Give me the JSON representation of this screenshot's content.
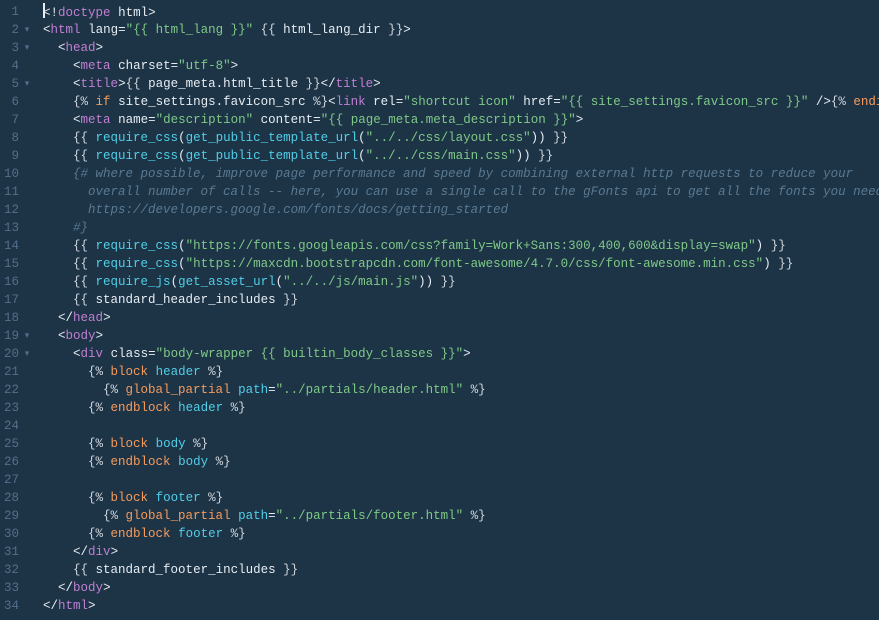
{
  "lines": [
    {
      "n": 1,
      "fold": false,
      "indent": 0,
      "cursor": true,
      "tokens": [
        {
          "c": "c-punct",
          "t": "<!"
        },
        {
          "c": "c-tag",
          "t": "doctype"
        },
        {
          "c": "",
          "t": " "
        },
        {
          "c": "c-attr",
          "t": "html"
        },
        {
          "c": "c-punct",
          "t": ">"
        }
      ]
    },
    {
      "n": 2,
      "fold": true,
      "indent": 0,
      "tokens": [
        {
          "c": "c-punct",
          "t": "<"
        },
        {
          "c": "c-tag",
          "t": "html"
        },
        {
          "c": "",
          "t": " "
        },
        {
          "c": "c-attr",
          "t": "lang"
        },
        {
          "c": "c-punct",
          "t": "="
        },
        {
          "c": "c-str",
          "t": "\"{{ html_lang }}\""
        },
        {
          "c": "",
          "t": " "
        },
        {
          "c": "c-delim",
          "t": "{{ "
        },
        {
          "c": "c-attr",
          "t": "html_lang_dir"
        },
        {
          "c": "c-delim",
          "t": " }}"
        },
        {
          "c": "c-punct",
          "t": ">"
        }
      ]
    },
    {
      "n": 3,
      "fold": true,
      "indent": 1,
      "tokens": [
        {
          "c": "c-punct",
          "t": "<"
        },
        {
          "c": "c-tag",
          "t": "head"
        },
        {
          "c": "c-punct",
          "t": ">"
        }
      ]
    },
    {
      "n": 4,
      "fold": false,
      "indent": 2,
      "tokens": [
        {
          "c": "c-punct",
          "t": "<"
        },
        {
          "c": "c-tag",
          "t": "meta"
        },
        {
          "c": "",
          "t": " "
        },
        {
          "c": "c-attr",
          "t": "charset"
        },
        {
          "c": "c-punct",
          "t": "="
        },
        {
          "c": "c-str",
          "t": "\"utf-8\""
        },
        {
          "c": "c-punct",
          "t": ">"
        }
      ]
    },
    {
      "n": 5,
      "fold": true,
      "indent": 2,
      "tokens": [
        {
          "c": "c-punct",
          "t": "<"
        },
        {
          "c": "c-tag",
          "t": "title"
        },
        {
          "c": "c-punct",
          "t": ">"
        },
        {
          "c": "c-delim",
          "t": "{{ "
        },
        {
          "c": "c-attr",
          "t": "page_meta.html_title"
        },
        {
          "c": "c-delim",
          "t": " }}"
        },
        {
          "c": "c-punct",
          "t": "</"
        },
        {
          "c": "c-tag",
          "t": "title"
        },
        {
          "c": "c-punct",
          "t": ">"
        }
      ]
    },
    {
      "n": 6,
      "fold": false,
      "indent": 2,
      "tokens": [
        {
          "c": "c-delim",
          "t": "{% "
        },
        {
          "c": "c-kw",
          "t": "if"
        },
        {
          "c": "",
          "t": " "
        },
        {
          "c": "c-attr",
          "t": "site_settings.favicon_src"
        },
        {
          "c": "c-delim",
          "t": " %}"
        },
        {
          "c": "c-punct",
          "t": "<"
        },
        {
          "c": "c-tag",
          "t": "link"
        },
        {
          "c": "",
          "t": " "
        },
        {
          "c": "c-attr",
          "t": "rel"
        },
        {
          "c": "c-punct",
          "t": "="
        },
        {
          "c": "c-str",
          "t": "\"shortcut icon\""
        },
        {
          "c": "",
          "t": " "
        },
        {
          "c": "c-attr",
          "t": "href"
        },
        {
          "c": "c-punct",
          "t": "="
        },
        {
          "c": "c-str",
          "t": "\"{{ site_settings.favicon_src }}\""
        },
        {
          "c": "",
          "t": " "
        },
        {
          "c": "c-punct",
          "t": "/>"
        },
        {
          "c": "c-delim",
          "t": "{% "
        },
        {
          "c": "c-kw",
          "t": "endif"
        },
        {
          "c": "c-delim",
          "t": " %}"
        }
      ]
    },
    {
      "n": 7,
      "fold": false,
      "indent": 2,
      "tokens": [
        {
          "c": "c-punct",
          "t": "<"
        },
        {
          "c": "c-tag",
          "t": "meta"
        },
        {
          "c": "",
          "t": " "
        },
        {
          "c": "c-attr",
          "t": "name"
        },
        {
          "c": "c-punct",
          "t": "="
        },
        {
          "c": "c-str",
          "t": "\"description\""
        },
        {
          "c": "",
          "t": " "
        },
        {
          "c": "c-attr",
          "t": "content"
        },
        {
          "c": "c-punct",
          "t": "="
        },
        {
          "c": "c-str",
          "t": "\"{{ page_meta.meta_description }}\""
        },
        {
          "c": "c-punct",
          "t": ">"
        }
      ]
    },
    {
      "n": 8,
      "fold": false,
      "indent": 2,
      "tokens": [
        {
          "c": "c-delim",
          "t": "{{ "
        },
        {
          "c": "c-call",
          "t": "require_css"
        },
        {
          "c": "c-punct",
          "t": "("
        },
        {
          "c": "c-call",
          "t": "get_public_template_url"
        },
        {
          "c": "c-punct",
          "t": "("
        },
        {
          "c": "c-str",
          "t": "\"../../css/layout.css\""
        },
        {
          "c": "c-punct",
          "t": "))"
        },
        {
          "c": "c-delim",
          "t": " }}"
        }
      ]
    },
    {
      "n": 9,
      "fold": false,
      "indent": 2,
      "tokens": [
        {
          "c": "c-delim",
          "t": "{{ "
        },
        {
          "c": "c-call",
          "t": "require_css"
        },
        {
          "c": "c-punct",
          "t": "("
        },
        {
          "c": "c-call",
          "t": "get_public_template_url"
        },
        {
          "c": "c-punct",
          "t": "("
        },
        {
          "c": "c-str",
          "t": "\"../../css/main.css\""
        },
        {
          "c": "c-punct",
          "t": "))"
        },
        {
          "c": "c-delim",
          "t": " }}"
        }
      ]
    },
    {
      "n": 10,
      "fold": false,
      "indent": 2,
      "tokens": [
        {
          "c": "c-cmt",
          "t": "{# where possible, improve page performance and speed by combining external http requests to reduce your"
        }
      ]
    },
    {
      "n": 11,
      "fold": false,
      "indent": 3,
      "tokens": [
        {
          "c": "c-cmt",
          "t": "overall number of calls -- here, you can use a single call to the gFonts api to get all the fonts you need"
        }
      ]
    },
    {
      "n": 12,
      "fold": false,
      "indent": 3,
      "tokens": [
        {
          "c": "c-cmt",
          "t": "https://developers.google.com/fonts/docs/getting_started"
        }
      ]
    },
    {
      "n": 13,
      "fold": false,
      "indent": 2,
      "tokens": [
        {
          "c": "c-cmt",
          "t": "#}"
        }
      ]
    },
    {
      "n": 14,
      "fold": false,
      "indent": 2,
      "tokens": [
        {
          "c": "c-delim",
          "t": "{{ "
        },
        {
          "c": "c-call",
          "t": "require_css"
        },
        {
          "c": "c-punct",
          "t": "("
        },
        {
          "c": "c-str",
          "t": "\"https://fonts.googleapis.com/css?family=Work+Sans:300,400,600&display=swap\""
        },
        {
          "c": "c-punct",
          "t": ")"
        },
        {
          "c": "c-delim",
          "t": " }}"
        }
      ]
    },
    {
      "n": 15,
      "fold": false,
      "indent": 2,
      "tokens": [
        {
          "c": "c-delim",
          "t": "{{ "
        },
        {
          "c": "c-call",
          "t": "require_css"
        },
        {
          "c": "c-punct",
          "t": "("
        },
        {
          "c": "c-str",
          "t": "\"https://maxcdn.bootstrapcdn.com/font-awesome/4.7.0/css/font-awesome.min.css\""
        },
        {
          "c": "c-punct",
          "t": ")"
        },
        {
          "c": "c-delim",
          "t": " }}"
        }
      ]
    },
    {
      "n": 16,
      "fold": false,
      "indent": 2,
      "tokens": [
        {
          "c": "c-delim",
          "t": "{{ "
        },
        {
          "c": "c-call",
          "t": "require_js"
        },
        {
          "c": "c-punct",
          "t": "("
        },
        {
          "c": "c-call",
          "t": "get_asset_url"
        },
        {
          "c": "c-punct",
          "t": "("
        },
        {
          "c": "c-str",
          "t": "\"../../js/main.js\""
        },
        {
          "c": "c-punct",
          "t": "))"
        },
        {
          "c": "c-delim",
          "t": " }}"
        }
      ]
    },
    {
      "n": 17,
      "fold": false,
      "indent": 2,
      "tokens": [
        {
          "c": "c-delim",
          "t": "{{ "
        },
        {
          "c": "c-attr",
          "t": "standard_header_includes"
        },
        {
          "c": "c-delim",
          "t": " }}"
        }
      ]
    },
    {
      "n": 18,
      "fold": false,
      "indent": 1,
      "tokens": [
        {
          "c": "c-punct",
          "t": "</"
        },
        {
          "c": "c-tag",
          "t": "head"
        },
        {
          "c": "c-punct",
          "t": ">"
        }
      ]
    },
    {
      "n": 19,
      "fold": true,
      "indent": 1,
      "tokens": [
        {
          "c": "c-punct",
          "t": "<"
        },
        {
          "c": "c-tag",
          "t": "body"
        },
        {
          "c": "c-punct",
          "t": ">"
        }
      ]
    },
    {
      "n": 20,
      "fold": true,
      "indent": 2,
      "tokens": [
        {
          "c": "c-punct",
          "t": "<"
        },
        {
          "c": "c-tag",
          "t": "div"
        },
        {
          "c": "",
          "t": " "
        },
        {
          "c": "c-attr",
          "t": "class"
        },
        {
          "c": "c-punct",
          "t": "="
        },
        {
          "c": "c-str",
          "t": "\"body-wrapper {{ builtin_body_classes }}\""
        },
        {
          "c": "c-punct",
          "t": ">"
        }
      ]
    },
    {
      "n": 21,
      "fold": false,
      "indent": 3,
      "tokens": [
        {
          "c": "c-delim",
          "t": "{% "
        },
        {
          "c": "c-block",
          "t": "block"
        },
        {
          "c": "",
          "t": " "
        },
        {
          "c": "c-name",
          "t": "header"
        },
        {
          "c": "c-delim",
          "t": " %}"
        }
      ]
    },
    {
      "n": 22,
      "fold": false,
      "indent": 4,
      "tokens": [
        {
          "c": "c-delim",
          "t": "{% "
        },
        {
          "c": "c-block",
          "t": "global_partial"
        },
        {
          "c": "",
          "t": " "
        },
        {
          "c": "c-name",
          "t": "path"
        },
        {
          "c": "c-punct",
          "t": "="
        },
        {
          "c": "c-str",
          "t": "\"../partials/header.html\""
        },
        {
          "c": "c-delim",
          "t": " %}"
        }
      ]
    },
    {
      "n": 23,
      "fold": false,
      "indent": 3,
      "tokens": [
        {
          "c": "c-delim",
          "t": "{% "
        },
        {
          "c": "c-block",
          "t": "endblock"
        },
        {
          "c": "",
          "t": " "
        },
        {
          "c": "c-name",
          "t": "header"
        },
        {
          "c": "c-delim",
          "t": " %}"
        }
      ]
    },
    {
      "n": 24,
      "fold": false,
      "indent": 3,
      "tokens": []
    },
    {
      "n": 25,
      "fold": false,
      "indent": 3,
      "tokens": [
        {
          "c": "c-delim",
          "t": "{% "
        },
        {
          "c": "c-block",
          "t": "block"
        },
        {
          "c": "",
          "t": " "
        },
        {
          "c": "c-name",
          "t": "body"
        },
        {
          "c": "c-delim",
          "t": " %}"
        }
      ]
    },
    {
      "n": 26,
      "fold": false,
      "indent": 3,
      "tokens": [
        {
          "c": "c-delim",
          "t": "{% "
        },
        {
          "c": "c-block",
          "t": "endblock"
        },
        {
          "c": "",
          "t": " "
        },
        {
          "c": "c-name",
          "t": "body"
        },
        {
          "c": "c-delim",
          "t": " %}"
        }
      ]
    },
    {
      "n": 27,
      "fold": false,
      "indent": 3,
      "tokens": []
    },
    {
      "n": 28,
      "fold": false,
      "indent": 3,
      "tokens": [
        {
          "c": "c-delim",
          "t": "{% "
        },
        {
          "c": "c-block",
          "t": "block"
        },
        {
          "c": "",
          "t": " "
        },
        {
          "c": "c-name",
          "t": "footer"
        },
        {
          "c": "c-delim",
          "t": " %}"
        }
      ]
    },
    {
      "n": 29,
      "fold": false,
      "indent": 4,
      "tokens": [
        {
          "c": "c-delim",
          "t": "{% "
        },
        {
          "c": "c-block",
          "t": "global_partial"
        },
        {
          "c": "",
          "t": " "
        },
        {
          "c": "c-name",
          "t": "path"
        },
        {
          "c": "c-punct",
          "t": "="
        },
        {
          "c": "c-str",
          "t": "\"../partials/footer.html\""
        },
        {
          "c": "c-delim",
          "t": " %}"
        }
      ]
    },
    {
      "n": 30,
      "fold": false,
      "indent": 3,
      "tokens": [
        {
          "c": "c-delim",
          "t": "{% "
        },
        {
          "c": "c-block",
          "t": "endblock"
        },
        {
          "c": "",
          "t": " "
        },
        {
          "c": "c-name",
          "t": "footer"
        },
        {
          "c": "c-delim",
          "t": " %}"
        }
      ]
    },
    {
      "n": 31,
      "fold": false,
      "indent": 2,
      "tokens": [
        {
          "c": "c-punct",
          "t": "</"
        },
        {
          "c": "c-tag",
          "t": "div"
        },
        {
          "c": "c-punct",
          "t": ">"
        }
      ]
    },
    {
      "n": 32,
      "fold": false,
      "indent": 2,
      "tokens": [
        {
          "c": "c-delim",
          "t": "{{ "
        },
        {
          "c": "c-attr",
          "t": "standard_footer_includes"
        },
        {
          "c": "c-delim",
          "t": " }}"
        }
      ]
    },
    {
      "n": 33,
      "fold": false,
      "indent": 1,
      "tokens": [
        {
          "c": "c-punct",
          "t": "</"
        },
        {
          "c": "c-tag",
          "t": "body"
        },
        {
          "c": "c-punct",
          "t": ">"
        }
      ]
    },
    {
      "n": 34,
      "fold": false,
      "indent": 0,
      "tokens": [
        {
          "c": "c-punct",
          "t": "</"
        },
        {
          "c": "c-tag",
          "t": "html"
        },
        {
          "c": "c-punct",
          "t": ">"
        }
      ]
    }
  ],
  "indent_unit": "  ",
  "fold_glyph": "▾"
}
